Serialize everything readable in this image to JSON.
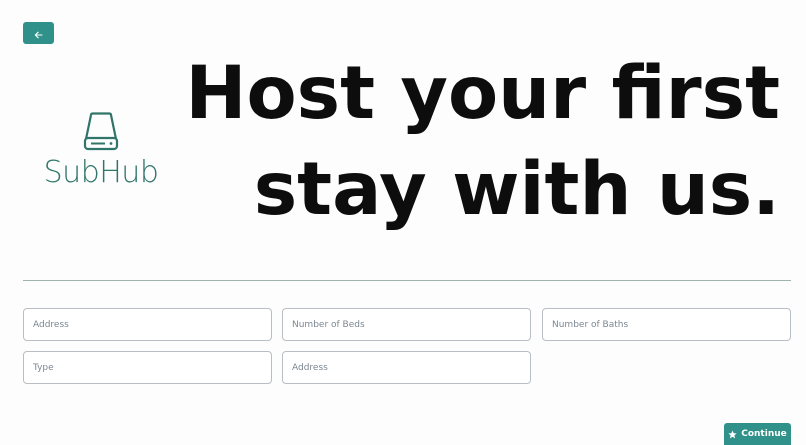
{
  "header": {
    "back_icon": "arrow-left-icon"
  },
  "logo": {
    "icon": "drive-icon",
    "text": "SubHub",
    "color": "#2f7569"
  },
  "hero": {
    "line1": "Host your first",
    "line2": "stay with us."
  },
  "form": {
    "address_placeholder": "Address",
    "beds_placeholder": "Number of Beds",
    "baths_placeholder": "Number of Baths",
    "type_placeholder": "Type",
    "address2_placeholder": "Address"
  },
  "actions": {
    "continue_label": "Continue",
    "continue_icon": "star-icon",
    "accent_color": "#2f918a"
  }
}
